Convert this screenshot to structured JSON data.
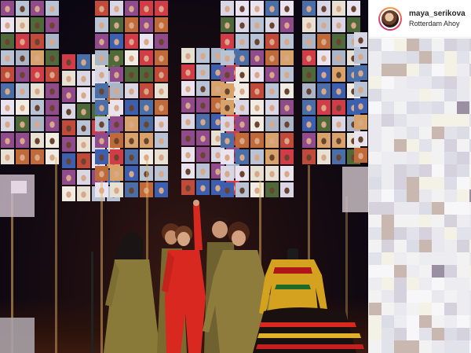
{
  "post": {
    "username": "maya_serikova",
    "location": "Rotterdam Ahoy"
  },
  "icons": {
    "avatar": "profile-avatar-icon"
  },
  "colors": {
    "header_text": "#262626",
    "divider": "#efefef",
    "avatar_ring": "#e6405b",
    "performer_red": "#d8281f",
    "performer_olive": "#8a7a3a"
  },
  "comments_pixelated": true
}
